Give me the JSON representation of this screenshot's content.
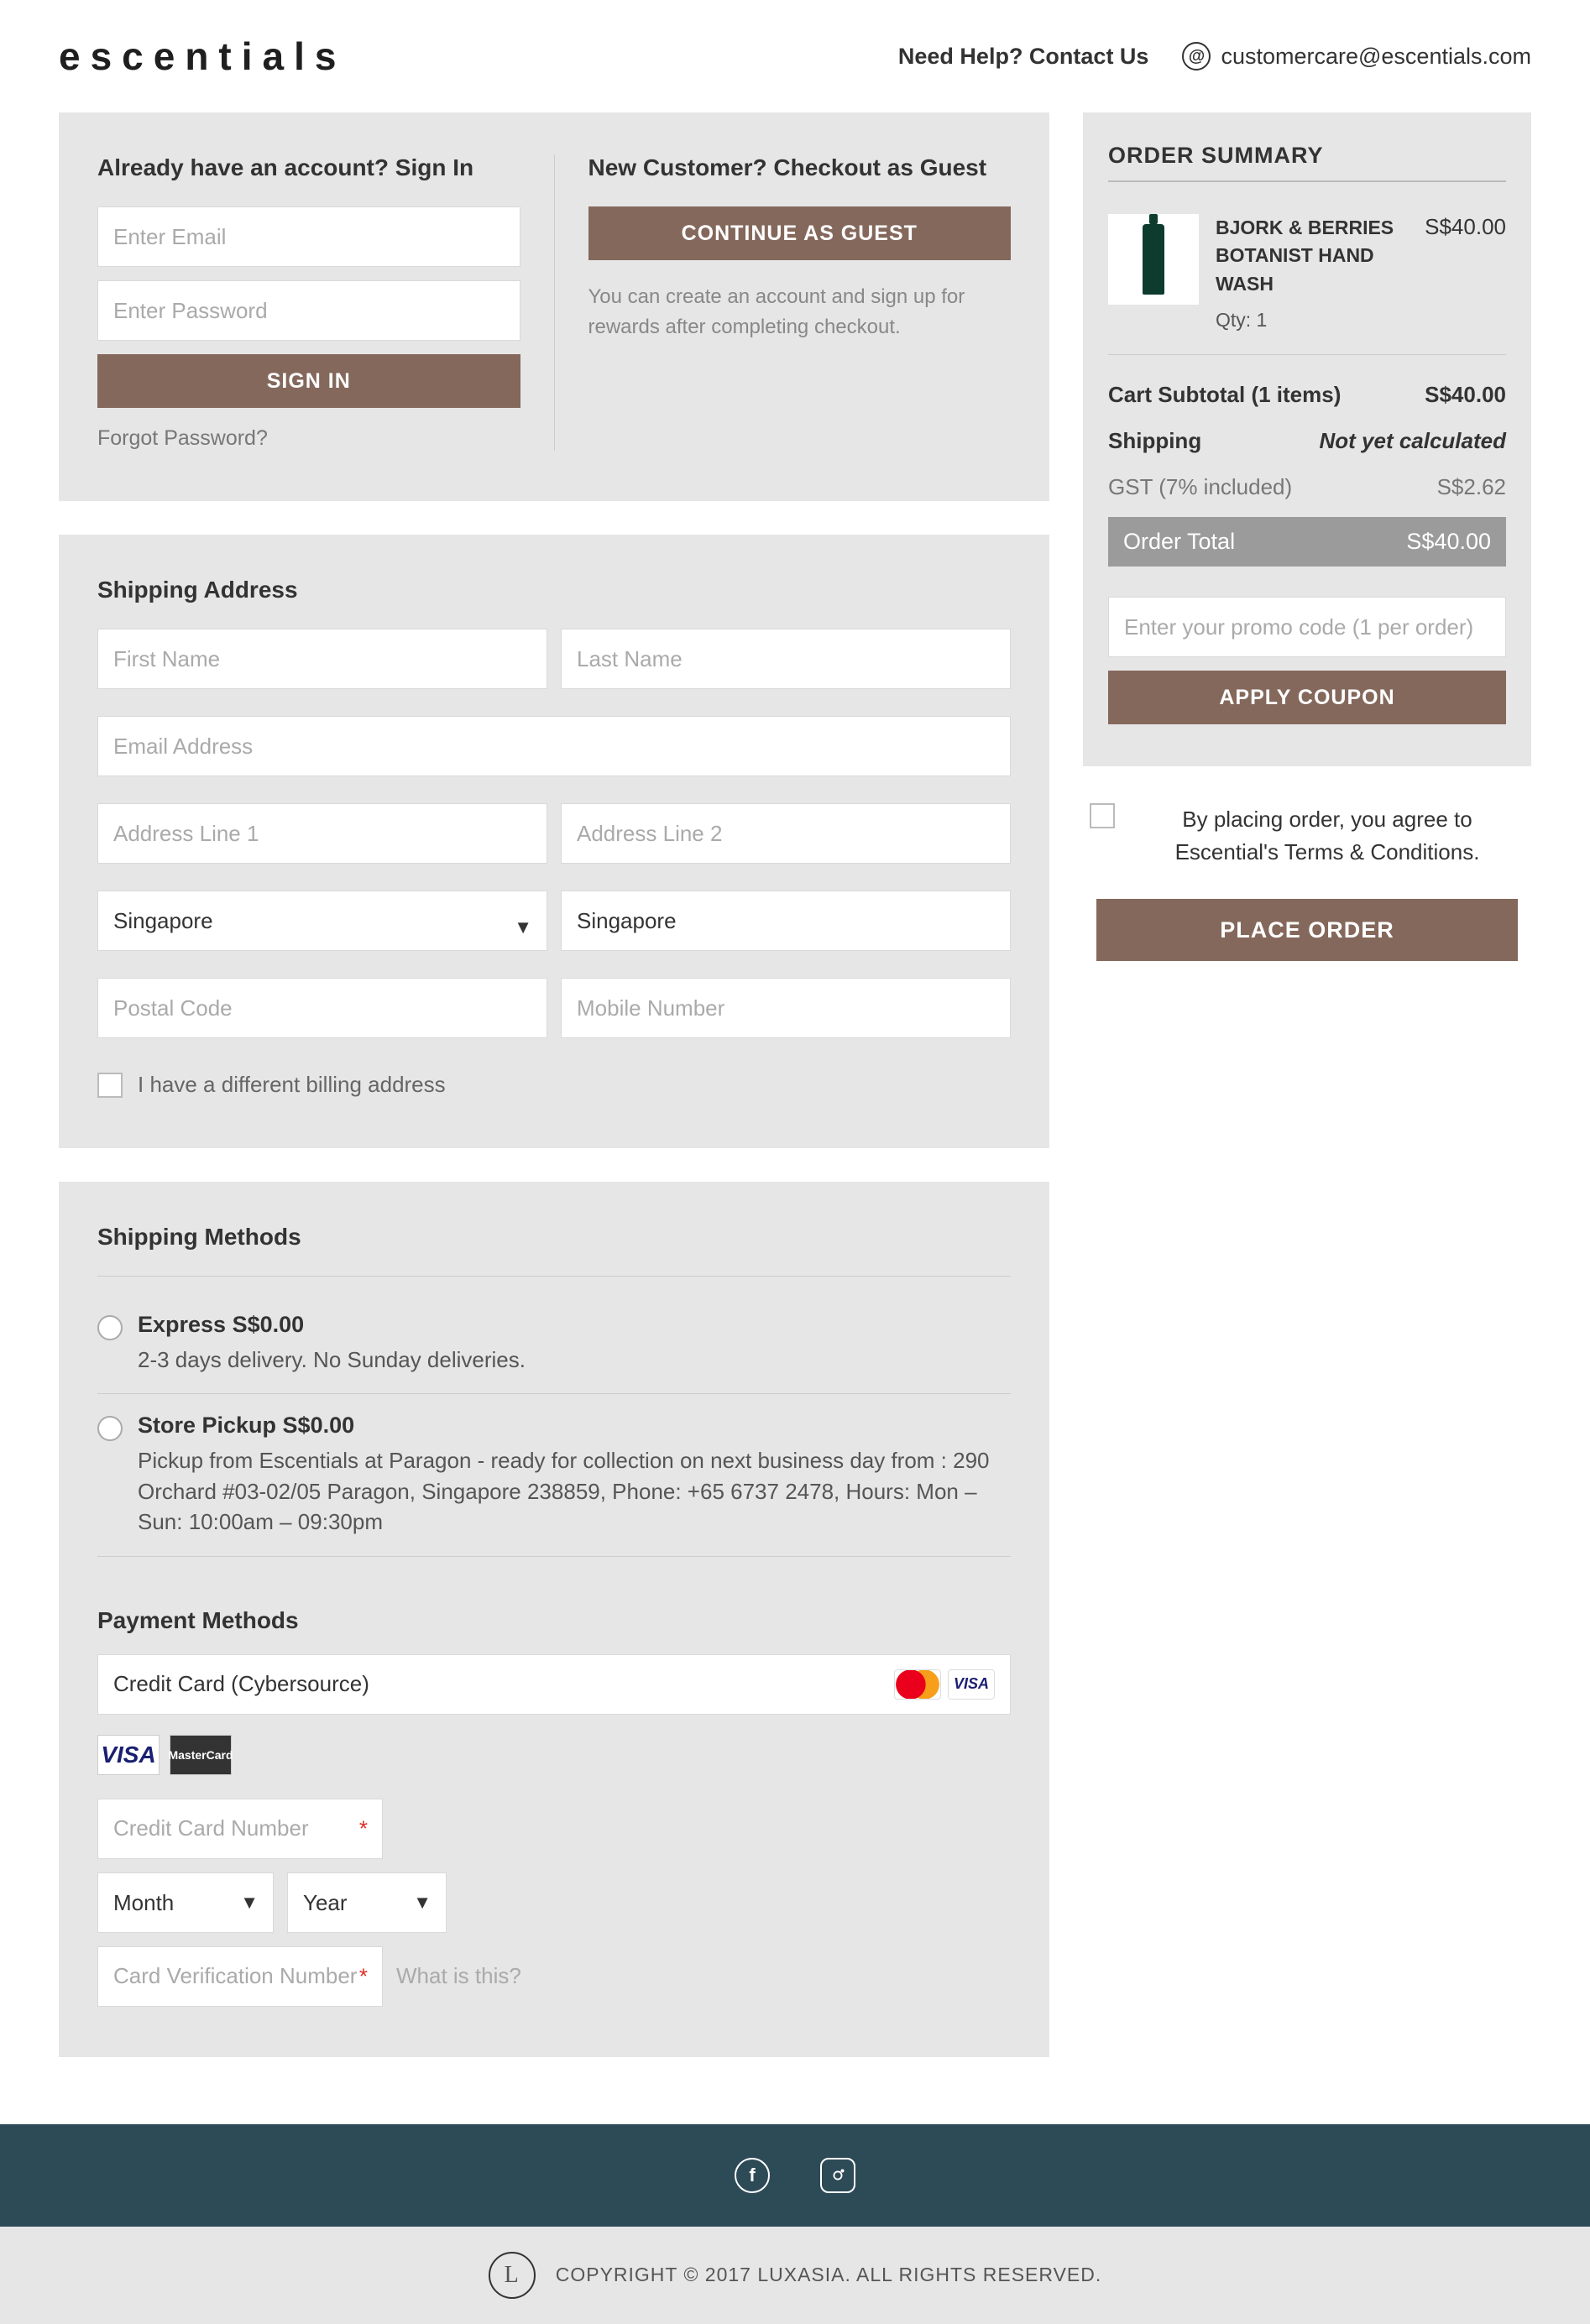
{
  "header": {
    "logo": "escentials",
    "help_label": "Need Help? Contact Us",
    "email": "customercare@escentials.com"
  },
  "signin": {
    "title": "Already have an account? Sign In",
    "email_ph": "Enter Email",
    "password_ph": "Enter Password",
    "button": "Sign In",
    "forgot": "Forgot Password?"
  },
  "guest": {
    "title": "New Customer? Checkout as Guest",
    "button": "Continue as Guest",
    "note": "You can create an account and sign up for rewards after completing checkout."
  },
  "shipping_address": {
    "title": "Shipping Address",
    "first_name_ph": "First Name",
    "last_name_ph": "Last Name",
    "email_ph": "Email Address",
    "addr1_ph": "Address Line 1",
    "addr2_ph": "Address Line 2",
    "country": "Singapore",
    "city": "Singapore",
    "postal_ph": "Postal Code",
    "mobile_ph": "Mobile Number",
    "diff_billing": "I have a different billing address"
  },
  "shipping_methods": {
    "title": "Shipping Methods",
    "options": [
      {
        "label": "Express S$0.00",
        "desc": "2-3 days delivery. No Sunday deliveries."
      },
      {
        "label": "Store Pickup S$0.00",
        "desc": "Pickup from Escentials at Paragon - ready for collection on next business day from : 290 Orchard #03-02/05 Paragon, Singapore 238859, Phone: +65 6737 2478, Hours: Mon – Sun: 10:00am – 09:30pm"
      }
    ]
  },
  "payment": {
    "title": "Payment Methods",
    "method_label": "Credit Card (Cybersource)",
    "cc_number_ph": "Credit Card Number",
    "month_ph": "Month",
    "year_ph": "Year",
    "cvn_ph": "Card Verification Number",
    "what_is_this": "What is this?"
  },
  "summary": {
    "title": "ORDER SUMMARY",
    "item": {
      "brand": "BJORK & BERRIES",
      "name": "BOTANIST HAND WASH",
      "qty_label": "Qty: 1",
      "price": "S$40.00"
    },
    "subtotal_label": "Cart Subtotal (1 items)",
    "subtotal_value": "S$40.00",
    "shipping_label": "Shipping",
    "shipping_value": "Not yet calculated",
    "gst_label": "GST (7% included)",
    "gst_value": "S$2.62",
    "total_label": "Order Total",
    "total_value": "S$40.00",
    "promo_ph": "Enter your promo code (1 per order)",
    "apply_btn": "Apply Coupon",
    "agree_text": "By placing order, you agree to Escential's Terms & Conditions.",
    "place_btn": "Place Order"
  },
  "footer": {
    "copyright": "COPYRIGHT © 2017 LUXASIA. ALL RIGHTS RESERVED."
  }
}
